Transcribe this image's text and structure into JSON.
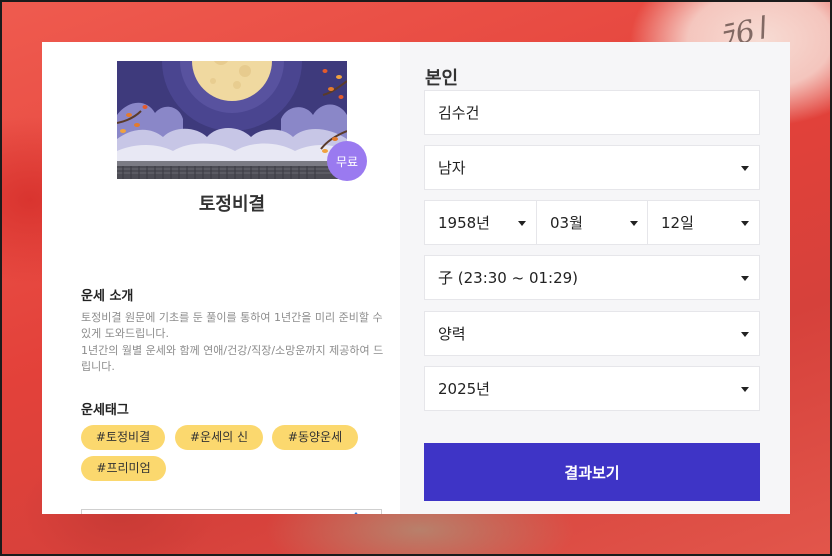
{
  "background": {
    "deco_text": "ﾗ6ا",
    "colors": {
      "primary": "#e8483f",
      "panel": "#f6f6f8",
      "button": "#3e34c6",
      "tag": "#fbd86e",
      "badge": "#9a7af0"
    }
  },
  "product": {
    "title": "토정비결",
    "badge": "무료",
    "intro_heading": "운세 소개",
    "intro_paragraphs": [
      "토정비결 원문에 기초를 둔 풀이를 통하여 1년간을 미리 준비할 수 있게 도와드립니다.",
      "1년간의 월별 운세와 함께 연애/건강/직장/소망운까지 제공하여 드립니다."
    ],
    "tags_heading": "운세태그",
    "tags": [
      "#토정비결",
      "#운세의 신",
      "#동양운세",
      "#프리미엄"
    ]
  },
  "form": {
    "section_label": "본인",
    "name_value": "김수건",
    "gender_value": "남자",
    "year_value": "1958년",
    "month_value": "03월",
    "day_value": "12일",
    "time_value": "子 (23:30 ~ 01:29)",
    "calendar_value": "양력",
    "target_year_value": "2025년",
    "submit_label": "결과보기"
  }
}
